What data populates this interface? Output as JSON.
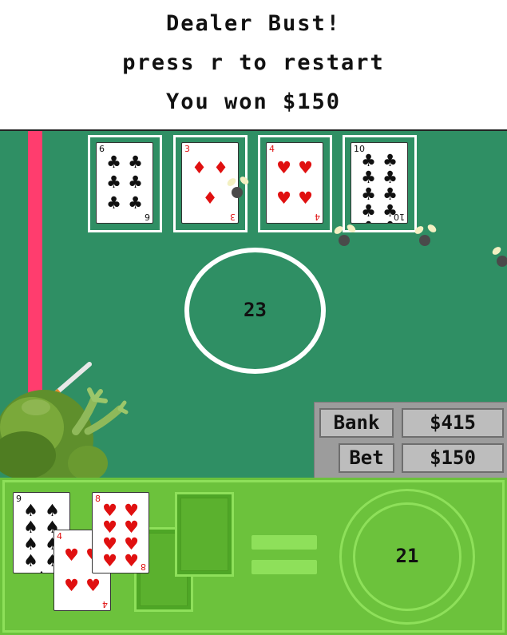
{
  "messages": {
    "line1": "Dealer Bust!",
    "line2": "press r to restart",
    "line3": "You won $150"
  },
  "dealer": {
    "score": "23",
    "cards": [
      {
        "rank": "6",
        "suit": "♣",
        "color": "black",
        "pips": [
          "♣",
          "♣",
          "♣",
          "♣",
          "♣",
          "♣"
        ]
      },
      {
        "rank": "3",
        "suit": "♦",
        "color": "red",
        "pips": [
          "♦",
          "♦",
          "♦"
        ]
      },
      {
        "rank": "4",
        "suit": "♥",
        "color": "red",
        "pips": [
          "♥",
          "♥",
          "♥",
          "♥"
        ]
      },
      {
        "rank": "10",
        "suit": "♣",
        "color": "black",
        "pips": [
          "♣",
          "♣",
          "♣",
          "♣",
          "♣",
          "♣",
          "♣",
          "♣",
          "♣",
          "♣"
        ]
      }
    ]
  },
  "stats": {
    "bank_label": "Bank",
    "bank_value": "$415",
    "bet_label": "Bet",
    "bet_value": "$150"
  },
  "player": {
    "score": "21",
    "cards": [
      {
        "rank": "9",
        "suit": "♠",
        "color": "black",
        "pips": [
          "♠",
          "♠",
          "♠",
          "♠",
          "♠",
          "♠",
          "♠",
          "♠",
          "♠"
        ]
      },
      {
        "rank": "4",
        "suit": "♥",
        "color": "red",
        "pips": [
          "♥",
          "♥",
          "♥",
          "♥"
        ]
      },
      {
        "rank": "8",
        "suit": "♥",
        "color": "red",
        "pips": [
          "♥",
          "♥",
          "♥",
          "♥",
          "♥",
          "♥",
          "♥",
          "♥"
        ]
      }
    ]
  },
  "colors": {
    "table": "#2f8f64",
    "player_area": "#6cc23c",
    "pole": "#ff3d6e"
  }
}
